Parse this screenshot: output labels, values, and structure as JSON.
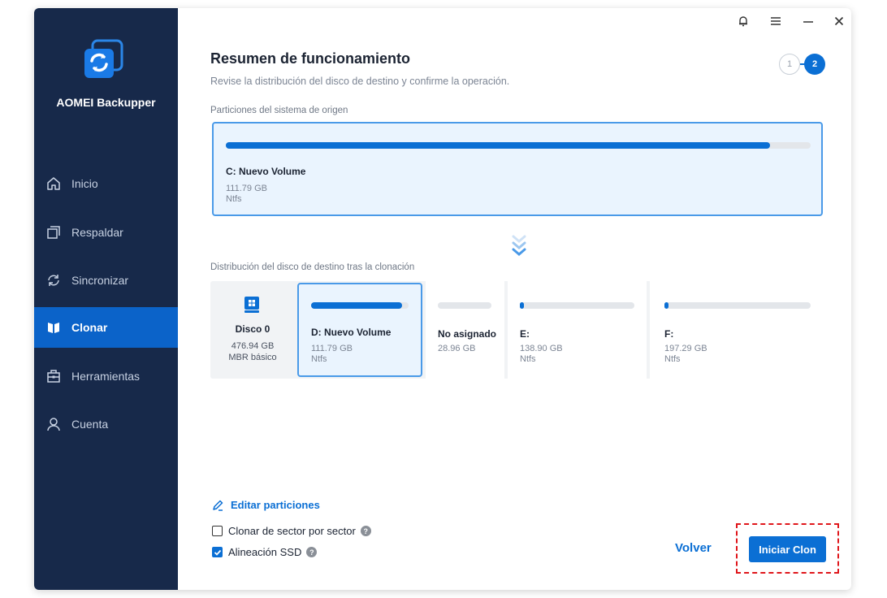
{
  "app": {
    "brand": "AOMEI Backupper"
  },
  "sidebar": {
    "items": [
      {
        "label": "Inicio",
        "icon": "home-icon"
      },
      {
        "label": "Respaldar",
        "icon": "backup-icon"
      },
      {
        "label": "Sincronizar",
        "icon": "sync-icon"
      },
      {
        "label": "Clonar",
        "icon": "clone-icon",
        "active": true
      },
      {
        "label": "Herramientas",
        "icon": "toolbox-icon"
      },
      {
        "label": "Cuenta",
        "icon": "user-icon"
      }
    ]
  },
  "header": {
    "title": "Resumen de funcionamiento",
    "subtitle": "Revise la distribución del disco de destino y confirme la operación.",
    "steps": [
      "1",
      "2"
    ],
    "current_step": "2"
  },
  "source": {
    "label": "Particiones del sistema de origen",
    "volume": {
      "name": "C: Nuevo Volume",
      "size": "111.79 GB",
      "fs": "Ntfs",
      "used_fraction": 0.93
    }
  },
  "destination": {
    "label": "Distribución del disco de destino tras la clonación",
    "disk": {
      "name": "Disco 0",
      "size": "476.94 GB",
      "type": "MBR básico"
    },
    "partitions": [
      {
        "name": "D: Nuevo Volume",
        "size": "111.79 GB",
        "fs": "Ntfs",
        "used_fraction": 0.93,
        "selected": true
      },
      {
        "name": "No asignado",
        "size": "28.96 GB",
        "fs": "",
        "used_fraction": 0
      },
      {
        "name": "E:",
        "size": "138.90 GB",
        "fs": "Ntfs",
        "used_fraction": 0.02
      },
      {
        "name": "F:",
        "size": "197.29 GB",
        "fs": "Ntfs",
        "used_fraction": 0.02
      }
    ]
  },
  "options": {
    "edit_partitions": "Editar particiones",
    "sector_by_sector": {
      "label": "Clonar de sector por sector",
      "checked": false
    },
    "ssd_alignment": {
      "label": "Alineación SSD",
      "checked": true
    }
  },
  "footer": {
    "back": "Volver",
    "start": "Iniciar Clon"
  },
  "colors": {
    "sidebar_bg": "#17294a",
    "accent": "#0b6fd4",
    "highlight_outline": "#e0161b"
  }
}
